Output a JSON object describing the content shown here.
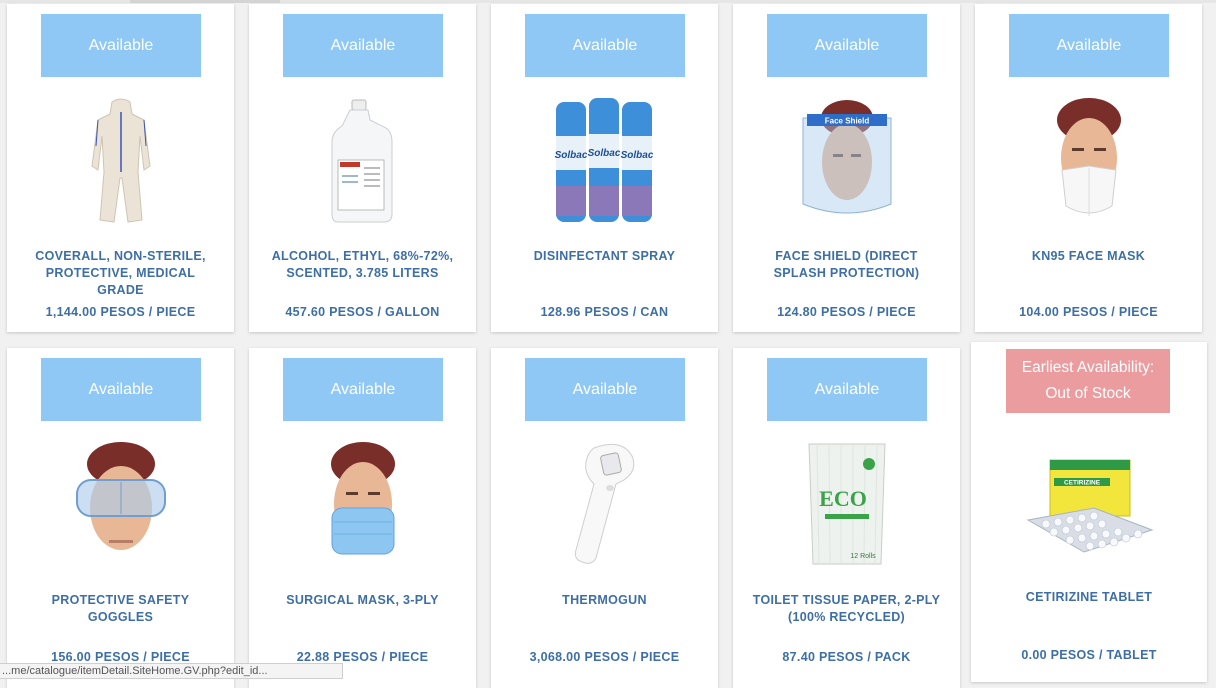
{
  "products": [
    {
      "status": "Available",
      "name": "COVERALL, NON-STERILE, PROTECTIVE, MEDICAL GRADE",
      "price": "1,144.00 PESOS / PIECE",
      "image": "coverall-image"
    },
    {
      "status": "Available",
      "name": "ALCOHOL, ETHYL, 68%-72%, SCENTED, 3.785 LITERS",
      "price": "457.60 PESOS / GALLON",
      "image": "alcohol-gallon-image"
    },
    {
      "status": "Available",
      "name": "DISINFECTANT SPRAY",
      "price": "128.96 PESOS / CAN",
      "image": "disinfectant-spray-image"
    },
    {
      "status": "Available",
      "name": "FACE SHIELD (DIRECT SPLASH PROTECTION)",
      "price": "124.80 PESOS / PIECE",
      "image": "face-shield-image"
    },
    {
      "status": "Available",
      "name": "KN95 FACE MASK",
      "price": "104.00 PESOS / PIECE",
      "image": "kn95-mask-image"
    },
    {
      "status": "Available",
      "name": "PROTECTIVE SAFETY GOGGLES",
      "price": "156.00 PESOS / PIECE",
      "image": "safety-goggles-image"
    },
    {
      "status": "Available",
      "name": "SURGICAL MASK, 3-PLY",
      "price": "22.88 PESOS / PIECE",
      "image": "surgical-mask-image"
    },
    {
      "status": "Available",
      "name": "THERMOGUN",
      "price": "3,068.00 PESOS / PIECE",
      "image": "thermogun-image"
    },
    {
      "status": "Available",
      "name": "TOILET TISSUE PAPER, 2-PLY (100% RECYCLED)",
      "price": "87.40 PESOS / PACK",
      "image": "toilet-tissue-image"
    },
    {
      "status_line1": "Earliest Availability:",
      "status_line2": "Out of Stock",
      "name": "CETIRIZINE TABLET",
      "price": "0.00 PESOS / TABLET",
      "image": "cetirizine-tablet-image"
    }
  ],
  "image_text": {
    "spray_brand": "Solbac",
    "face_shield_label": "Face Shield",
    "tissue_brand": "ECO",
    "tissue_rolls": "12 Rolls",
    "tablet_box_label": "CETIRIZINE"
  },
  "status_url": "...me/catalogue/itemDetail.SiteHome.GV.php?edit_id...",
  "colors": {
    "available_badge": "#90c8f5",
    "out_of_stock_badge": "#eb9c9f",
    "product_text": "#3d6fa6"
  }
}
